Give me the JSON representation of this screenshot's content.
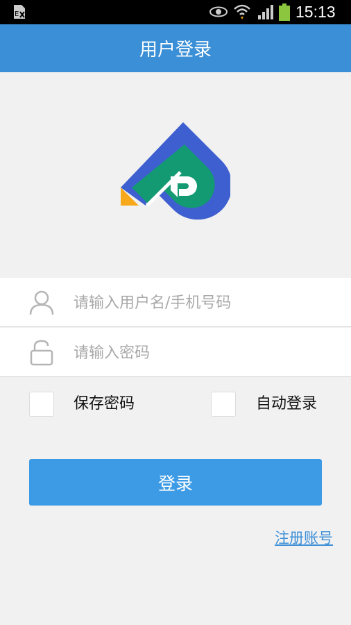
{
  "status_bar": {
    "time": "15:13",
    "icons": [
      "sim-card-icon",
      "eye-icon",
      "wifi-icon",
      "signal-icon",
      "battery-icon"
    ]
  },
  "header": {
    "title": "用户登录",
    "background": "#3a8fd6"
  },
  "logo": {
    "colors": {
      "blue": "#3e5fd0",
      "green": "#139a72",
      "orange": "#f7a81b"
    }
  },
  "form": {
    "username": {
      "placeholder": "请输入用户名/手机号码",
      "value": "",
      "icon": "user-icon"
    },
    "password": {
      "placeholder": "请输入密码",
      "value": "",
      "icon": "lock-icon"
    },
    "save_password": {
      "label": "保存密码",
      "checked": false
    },
    "auto_login": {
      "label": "自动登录",
      "checked": false
    },
    "login_button": "登录",
    "register_link": "注册账号"
  },
  "colors": {
    "accent": "#3d9be6",
    "link": "#3d8fd8",
    "page_background": "#f1f1f1"
  }
}
